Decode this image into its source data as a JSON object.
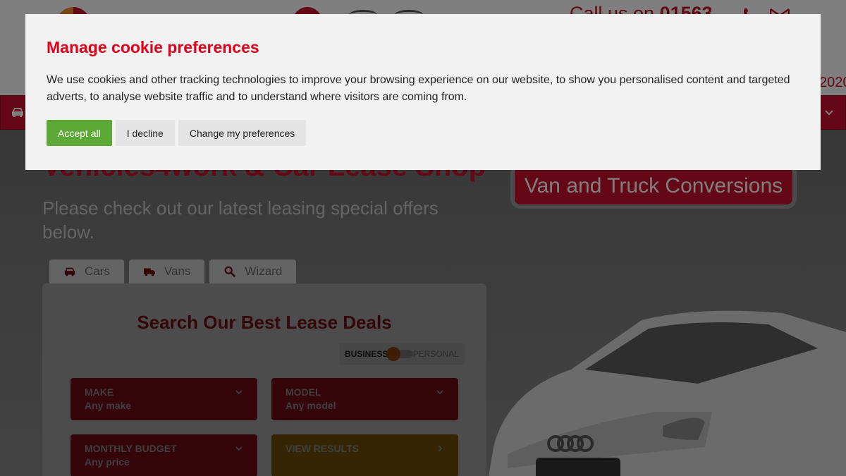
{
  "header": {
    "call_prefix": "Call us on",
    "call_number": "01563",
    "year_text": "2020",
    "icons": [
      "phone-icon",
      "email-icon"
    ]
  },
  "nav": {
    "icons": [
      "car-icon",
      "chevron-down-icon"
    ]
  },
  "hero": {
    "title": "Vehicles4work & Car Lease Shop",
    "subtitle": "Please check out our latest leasing special offers below.",
    "conversions_button": "Van and Truck Conversions"
  },
  "search": {
    "tabs": [
      {
        "label": "Cars",
        "icon": "car-icon"
      },
      {
        "label": "Vans",
        "icon": "truck-icon"
      },
      {
        "label": "Wizard",
        "icon": "search-icon"
      }
    ],
    "title": "Search Our Best Lease Deals",
    "toggle": {
      "left": "BUSINESS",
      "right": "PERSONAL"
    },
    "fields": [
      {
        "label": "MAKE",
        "value": "Any make"
      },
      {
        "label": "MODEL",
        "value": "Any model"
      },
      {
        "label": "MONTHLY BUDGET",
        "value": "Any price"
      },
      {
        "label": "VIEW RESULTS",
        "value": ""
      }
    ]
  },
  "cookie": {
    "title": "Manage cookie preferences",
    "body": "We use cookies and other tracking technologies to improve your browsing experience on our website, to show you personalised content and targeted adverts, to analyse website traffic and to understand where visitors are coming from.",
    "buttons": {
      "accept": "Accept all",
      "decline": "I decline",
      "change": "Change my preferences"
    }
  },
  "colors": {
    "brand_red": "#c8102e",
    "cookie_title_red": "#e2001a",
    "accept_green": "#5ca935"
  }
}
